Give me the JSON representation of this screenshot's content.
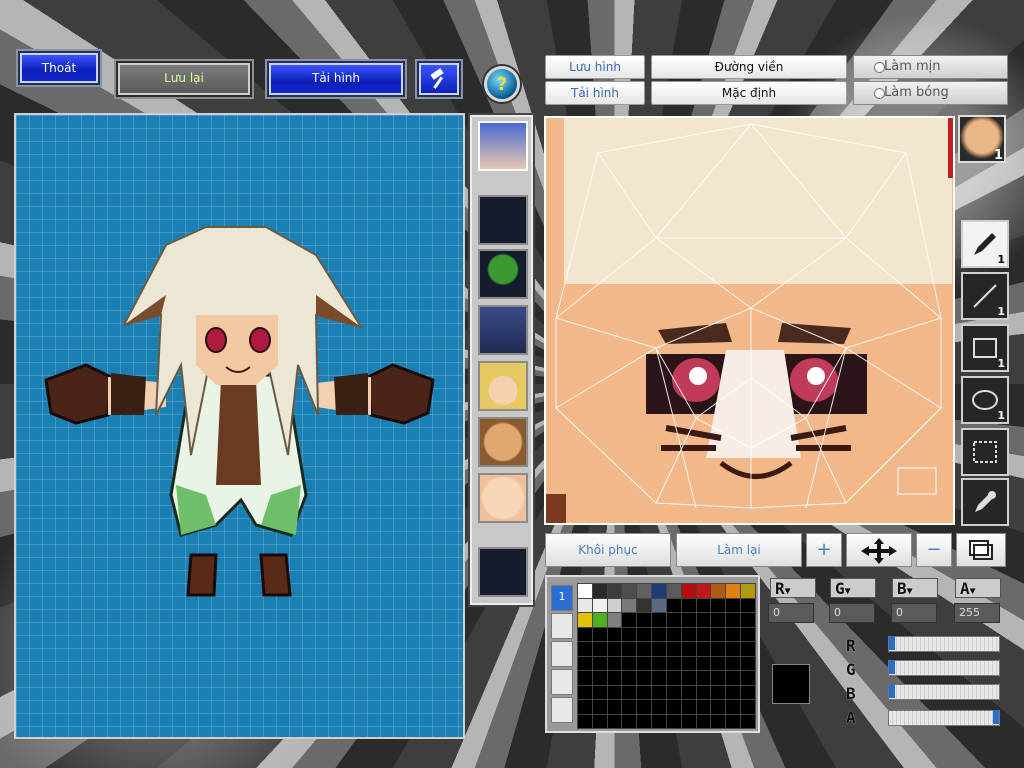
{
  "top_left": {
    "exit_label": "Thoát",
    "save_label": "Lưu lại",
    "reload_label": "Tải hình"
  },
  "top_right": {
    "save_image": "Lưu hình",
    "load_image": "Tải hình",
    "outline": "Đường viền",
    "default": "Mặc định",
    "smooth": "Làm mịn",
    "shading": "Làm bóng"
  },
  "texture": {
    "part_count": "1"
  },
  "tools": [
    {
      "name": "pen-tool",
      "count": "1"
    },
    {
      "name": "line-tool",
      "count": "1"
    },
    {
      "name": "rect-tool",
      "count": "1"
    },
    {
      "name": "ellipse-tool",
      "count": "1"
    },
    {
      "name": "select-tool",
      "count": ""
    },
    {
      "name": "eyedropper-tool",
      "count": ""
    }
  ],
  "actions": {
    "restore": "Khôi phục",
    "redo": "Làm lại"
  },
  "palette": {
    "tab_active": "1",
    "colors": [
      "#ffffff",
      "#2a2a2a",
      "#3c3c3c",
      "#4e4e4e",
      "#606060",
      "#1e3d78",
      "#5a5a5a",
      "#b01010",
      "#c01818",
      "#b05a10",
      "#e08010",
      "#b09a10",
      "#e8e8e8",
      "#f0f0f0",
      "#cfcfcf",
      "#7a7a7a",
      "#333333",
      "#5a6a80",
      "#000000",
      "#000000",
      "#000000",
      "#000000",
      "#000000",
      "#000000",
      "#e0c000",
      "#50b020",
      "#808080"
    ]
  },
  "color": {
    "r_label": "R",
    "g_label": "G",
    "b_label": "B",
    "a_label": "A",
    "r": "0",
    "g": "0",
    "b": "0",
    "a": "255",
    "current": "#000000",
    "r_slider": 0,
    "g_slider": 0,
    "b_slider": 0,
    "a_slider": 1
  }
}
